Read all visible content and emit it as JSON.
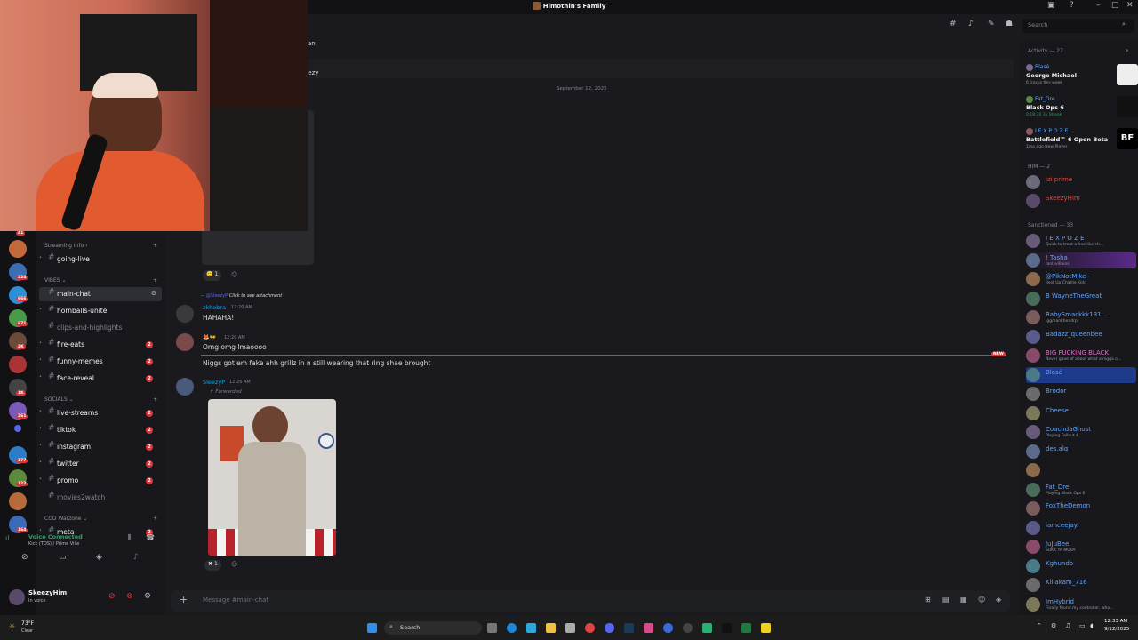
{
  "window": {
    "title": "Himothin's Family"
  },
  "header": {
    "search_placeholder": "Search"
  },
  "sidebar": {
    "categories": [
      {
        "label": "Streaming Info"
      },
      {
        "label": "VIBES"
      },
      {
        "label": "SOCIALS"
      },
      {
        "label": "COD Warzone"
      }
    ],
    "channels": [
      {
        "name": "going-live",
        "badge": ""
      },
      {
        "name": "main-chat",
        "badge": ""
      },
      {
        "name": "hornballs-unite",
        "badge": ""
      },
      {
        "name": "clips-and-highlights",
        "badge": ""
      },
      {
        "name": "fire-eats",
        "badge": "2"
      },
      {
        "name": "funny-memes",
        "badge": "2"
      },
      {
        "name": "face-reveal",
        "badge": "2"
      },
      {
        "name": "live-streams",
        "badge": "2"
      },
      {
        "name": "tiktok",
        "badge": "2"
      },
      {
        "name": "instagram",
        "badge": "2"
      },
      {
        "name": "twitter",
        "badge": "2"
      },
      {
        "name": "promo",
        "badge": "2"
      },
      {
        "name": "movies2watch",
        "badge": ""
      },
      {
        "name": "meta",
        "badge": "2"
      }
    ],
    "rail_badges": [
      "41",
      "224",
      "666",
      "671",
      "2K",
      "1K",
      "261",
      "177",
      "122",
      "164"
    ]
  },
  "voice": {
    "status": "Voice Connected",
    "channel": "Kick (TOS) / Prime Ville"
  },
  "user": {
    "name": "SkeezyHim",
    "status": "In voice"
  },
  "chat": {
    "date_divider": "September 12, 2025",
    "partial_top_1": "an",
    "partial_top_2": "eezy",
    "messages": [
      {
        "reply_to": "@SleezyP",
        "reply_text": "Click to see attachment",
        "author": "zkhobra",
        "time": "12:20 AM",
        "text": "HAHAHA!"
      },
      {
        "author": "",
        "time": "12:20 AM",
        "text": "Omg omg lmaoooo",
        "text2": "Niggs got em fake ahh grillz in n still wearing that ring shae brought"
      },
      {
        "author": "SleezyP",
        "time": "12:26 AM",
        "forwarded": "Forwarded"
      }
    ],
    "reactions": [
      {
        "count": "1"
      },
      {
        "count": "1"
      }
    ],
    "new_label": "NEW",
    "composer_placeholder": "Message #main-chat"
  },
  "members": {
    "activity_header": "Activity — 27",
    "activities": [
      {
        "user": "Blasé",
        "title": "George Michael",
        "sub": "6 tracks this week"
      },
      {
        "user": "Fat_Dre",
        "title": "Black Ops 6",
        "sub": "0:18:20  3x Streak"
      },
      {
        "user": "I E X P O Z E",
        "title": "Battlefield™ 6 Open Beta",
        "sub": "1mo ago  New Player"
      }
    ],
    "him_header": "HIM — 2",
    "him": [
      {
        "name": "izi prime",
        "color": "#e8443a",
        "sub": ""
      },
      {
        "name": "SkeezyHim",
        "color": "#e8443a",
        "sub": ""
      }
    ],
    "sanctioned_header": "Sanctioned — 33",
    "sanctioned": [
      {
        "name": "I E X P O Z E",
        "color": "#5ea4ff",
        "sub": "Quick to treat a hoe like sh..."
      },
      {
        "name": "! Tasha",
        "color": "#5ea4ff",
        "sub": "/onlyvillains"
      },
      {
        "name": "@PikNotMike -",
        "color": "#5ea4ff",
        "sub": "Rest Up Charlie Kirk"
      },
      {
        "name": "B WayneTheGreat",
        "color": "#5ea4ff",
        "sub": ""
      },
      {
        "name": "BabySmackkk131...",
        "color": "#5ea4ff",
        "sub": ".gg/bankheadrp"
      },
      {
        "name": "Badazz_queenbee",
        "color": "#5ea4ff",
        "sub": ""
      },
      {
        "name": "BIG FUCKING BLACK",
        "color": "#e96acb",
        "sub": "Never gave af about what a nigga o..."
      },
      {
        "name": "Blasé",
        "color": "#5ea4ff",
        "sub": ""
      },
      {
        "name": "Brodor",
        "color": "#5ea4ff",
        "sub": ""
      },
      {
        "name": "Cheese",
        "color": "#5ea4ff",
        "sub": ""
      },
      {
        "name": "CoachdaGhost",
        "color": "#5ea4ff",
        "sub": "Playing Fallout 4"
      },
      {
        "name": "des.alα",
        "color": "#5ea4ff",
        "sub": ""
      },
      {
        "name": "",
        "color": "#e8443a",
        "sub": ""
      },
      {
        "name": "Fat_Dre",
        "color": "#5ea4ff",
        "sub": "Playing Black Ops 6"
      },
      {
        "name": "FoxTheDemon",
        "color": "#5ea4ff",
        "sub": ""
      },
      {
        "name": "iamceejay.",
        "color": "#5ea4ff",
        "sub": ""
      },
      {
        "name": "JuJuBee.",
        "color": "#5ea4ff",
        "sub": "SUKK YA MUVA"
      },
      {
        "name": "Kghundo",
        "color": "#5ea4ff",
        "sub": ""
      },
      {
        "name": "Killakam_716",
        "color": "#5ea4ff",
        "sub": ""
      },
      {
        "name": "ImHybrid",
        "color": "#5ea4ff",
        "sub": "Finally found my controller, who..."
      }
    ]
  },
  "taskbar": {
    "weather_temp": "73°F",
    "weather_cond": "Clear",
    "search_label": "Search",
    "time": "12:33 AM",
    "date": "9/12/2025"
  },
  "colors": {
    "accent": "#5865f2",
    "mention": "#da373c",
    "link": "#00a8fc"
  }
}
